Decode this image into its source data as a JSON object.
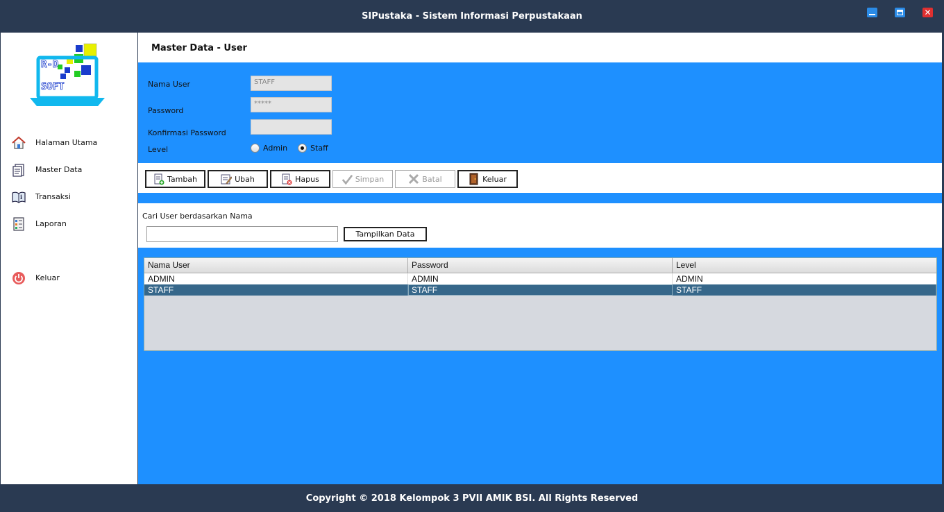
{
  "window": {
    "title": "SIPustaka - Sistem Informasi Perpustakaan",
    "min_icon": "minimize-icon",
    "max_icon": "maximize-icon",
    "close_icon": "close-icon",
    "close_glyph": "✕"
  },
  "sidebar": {
    "logo_text_top": "R-D",
    "logo_text_bottom": "SOFT",
    "items": [
      {
        "label": "Halaman Utama",
        "icon": "home-icon"
      },
      {
        "label": "Master Data",
        "icon": "document-icon"
      },
      {
        "label": "Transaksi",
        "icon": "book-info-icon"
      },
      {
        "label": "Laporan",
        "icon": "report-icon"
      },
      {
        "label": "Keluar",
        "icon": "power-icon"
      }
    ]
  },
  "page": {
    "title": "Master Data - User"
  },
  "form": {
    "nama_user_label": "Nama User",
    "nama_user_value": "STAFF",
    "password_label": "Password",
    "password_value": "*****",
    "konfirmasi_label": "Konfirmasi Password",
    "konfirmasi_value": "",
    "level_label": "Level",
    "level_options": [
      "Admin",
      "Staff"
    ],
    "level_selected": "Staff"
  },
  "toolbar": {
    "tambah": "Tambah",
    "ubah": "Ubah",
    "hapus": "Hapus",
    "simpan": "Simpan",
    "batal": "Batal",
    "keluar": "Keluar"
  },
  "search": {
    "label": "Cari User berdasarkan Nama",
    "value": "",
    "button": "Tampilkan Data"
  },
  "table": {
    "columns": [
      "Nama User",
      "Password",
      "Level"
    ],
    "rows": [
      [
        "ADMIN",
        "ADMIN",
        "ADMIN"
      ],
      [
        "STAFF",
        "STAFF",
        "STAFF"
      ]
    ],
    "selected_row": 1
  },
  "footer": {
    "text": "Copyright © 2018 Kelompok 3 PVII AMIK BSI. All Rights Reserved"
  },
  "colors": {
    "titlebar": "#2a3a52",
    "main_bg": "#1e90ff",
    "selected_row": "#36678a",
    "close_btn": "#e03030"
  }
}
